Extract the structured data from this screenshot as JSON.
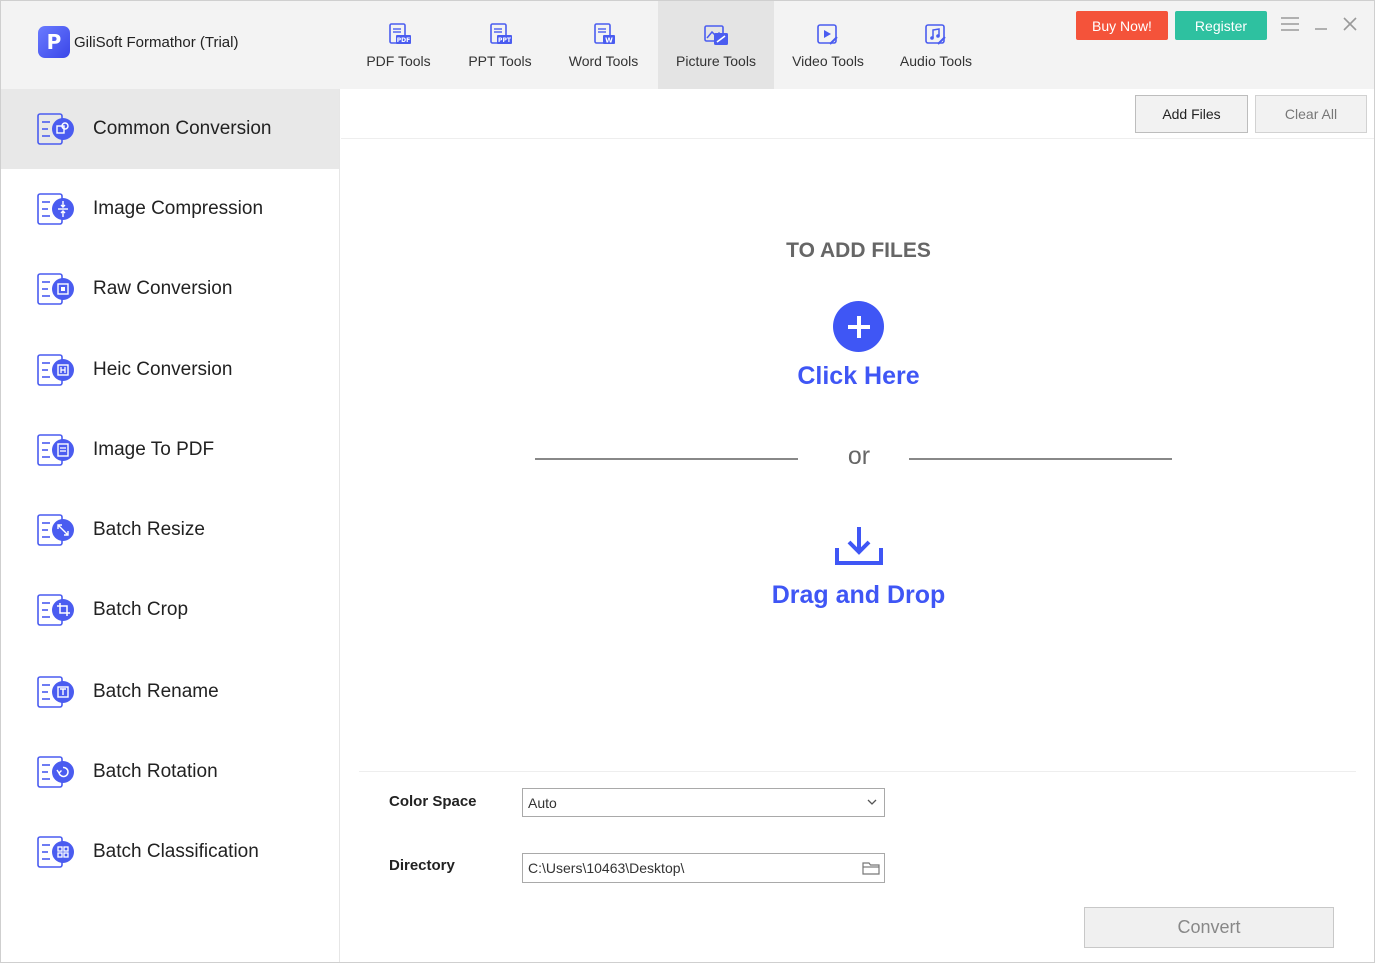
{
  "app": {
    "title": "GiliSoft Formathor (Trial)",
    "logo_letter": "P"
  },
  "nav": {
    "tabs": [
      {
        "label": "PDF Tools",
        "icon": "pdf-doc-icon",
        "badge": "PDF"
      },
      {
        "label": "PPT Tools",
        "icon": "ppt-doc-icon",
        "badge": "PPT"
      },
      {
        "label": "Word Tools",
        "icon": "word-doc-icon",
        "badge": "W"
      },
      {
        "label": "Picture Tools",
        "icon": "picture-icon",
        "active": true
      },
      {
        "label": "Video Tools",
        "icon": "video-icon"
      },
      {
        "label": "Audio Tools",
        "icon": "audio-icon"
      }
    ]
  },
  "header": {
    "buy_label": "Buy Now!",
    "register_label": "Register"
  },
  "sidebar": {
    "items": [
      {
        "label": "Common Conversion",
        "icon": "common-conversion-icon",
        "active": true
      },
      {
        "label": "Image Compression",
        "icon": "image-compression-icon"
      },
      {
        "label": "Raw Conversion",
        "icon": "raw-conversion-icon"
      },
      {
        "label": "Heic Conversion",
        "icon": "heic-conversion-icon"
      },
      {
        "label": "Image To PDF",
        "icon": "image-to-pdf-icon"
      },
      {
        "label": "Batch Resize",
        "icon": "batch-resize-icon"
      },
      {
        "label": "Batch Crop",
        "icon": "batch-crop-icon"
      },
      {
        "label": "Batch Rename",
        "icon": "batch-rename-icon"
      },
      {
        "label": "Batch Rotation",
        "icon": "batch-rotation-icon"
      },
      {
        "label": "Batch Classification",
        "icon": "batch-classification-icon"
      }
    ]
  },
  "toolbar": {
    "add_files_label": "Add Files",
    "clear_all_label": "Clear All"
  },
  "dropzone": {
    "title": "TO ADD FILES",
    "click_label": "Click Here",
    "or_label": "or",
    "drag_label": "Drag and Drop"
  },
  "settings": {
    "color_space_label": "Color Space",
    "color_space_value": "Auto",
    "directory_label": "Directory",
    "directory_value": "C:\\Users\\10463\\Desktop\\"
  },
  "convert_label": "Convert",
  "colors": {
    "accent": "#3f56f5",
    "buy": "#f4533a",
    "register": "#2ec1a0",
    "icon_blue": "#4a5cf0"
  }
}
